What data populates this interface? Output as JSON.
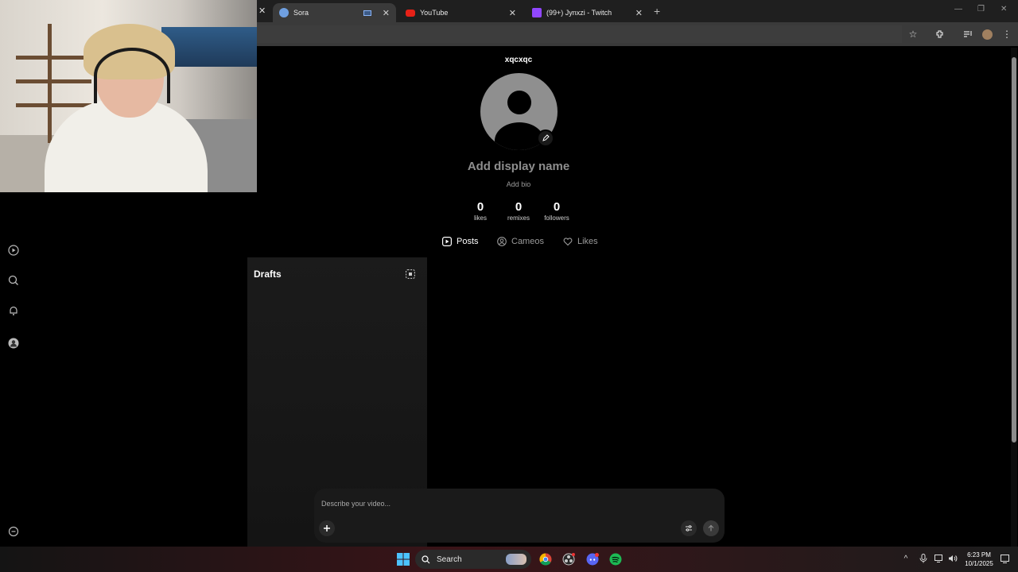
{
  "browser": {
    "tabs": [
      {
        "title": "Sora",
        "active": true
      },
      {
        "title": "YouTube",
        "active": false
      },
      {
        "title": "(99+) Jynxzi - Twitch",
        "active": false
      }
    ],
    "new_tab_symbol": "+",
    "close_symbol": "✕"
  },
  "profile": {
    "username": "xqcxqc",
    "display_name_placeholder": "Add display name",
    "bio_placeholder": "Add bio",
    "stats": [
      {
        "value": "0",
        "label": "likes"
      },
      {
        "value": "0",
        "label": "remixes"
      },
      {
        "value": "0",
        "label": "followers"
      }
    ],
    "tabs": [
      {
        "label": "Posts",
        "icon": "play-square-icon",
        "active": true
      },
      {
        "label": "Cameos",
        "icon": "person-circle-icon",
        "active": false
      },
      {
        "label": "Likes",
        "icon": "heart-icon",
        "active": false
      }
    ]
  },
  "drafts": {
    "title": "Drafts"
  },
  "composer": {
    "placeholder": "Describe your video..."
  },
  "taskbar": {
    "search_label": "Search",
    "time": "6:23 PM",
    "date": "10/1/2025"
  },
  "colors": {
    "background": "#000000",
    "panel": "#1a1a1a",
    "muted_text": "#8e8e8e",
    "avatar": "#8f8f8f"
  }
}
